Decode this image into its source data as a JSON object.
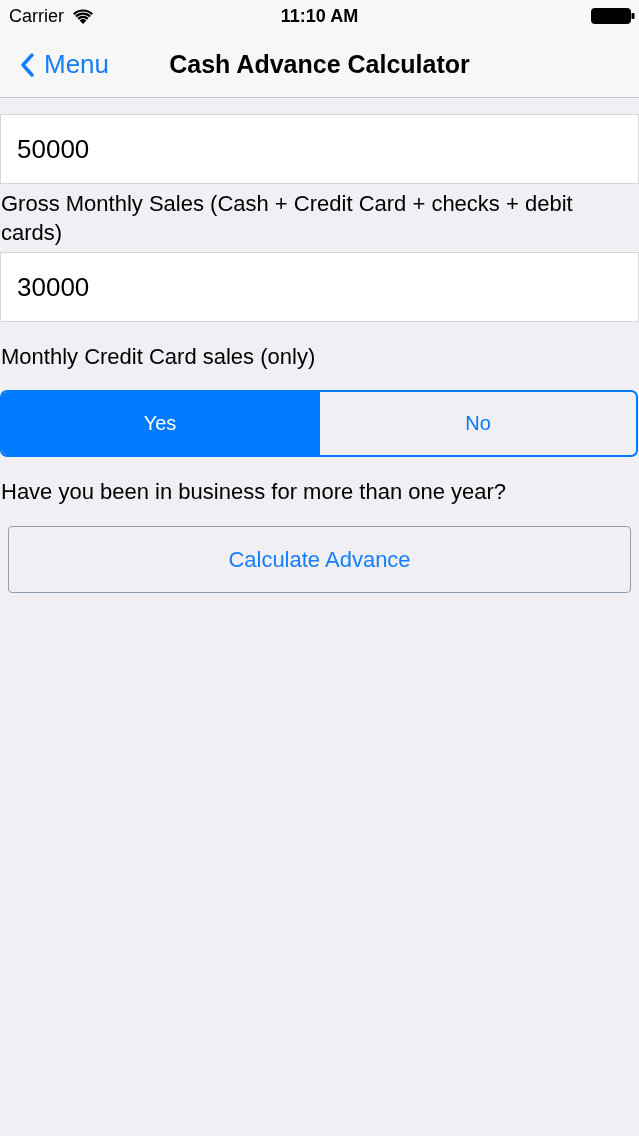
{
  "status_bar": {
    "carrier": "Carrier",
    "time": "11:10 AM"
  },
  "nav_bar": {
    "back_label": "Menu",
    "title": "Cash Advance Calculator"
  },
  "form": [
    {
      "kind": "field",
      "value": "50000"
    },
    {
      "kind": "label",
      "text": "Gross Monthly Sales (Cash + Credit Card + checks + debit cards)"
    },
    {
      "kind": "field",
      "value": "30000"
    },
    {
      "kind": "label",
      "text": "Monthly Credit Card sales (only)"
    },
    {
      "kind": "segmented",
      "segments": [
        {
          "label": "Yes",
          "selected": true
        },
        {
          "label": "No",
          "selected": false
        }
      ]
    },
    {
      "kind": "label",
      "text": "Have you been in business for more than one year?"
    },
    {
      "kind": "button",
      "label": "Calculate Advance"
    }
  ]
}
